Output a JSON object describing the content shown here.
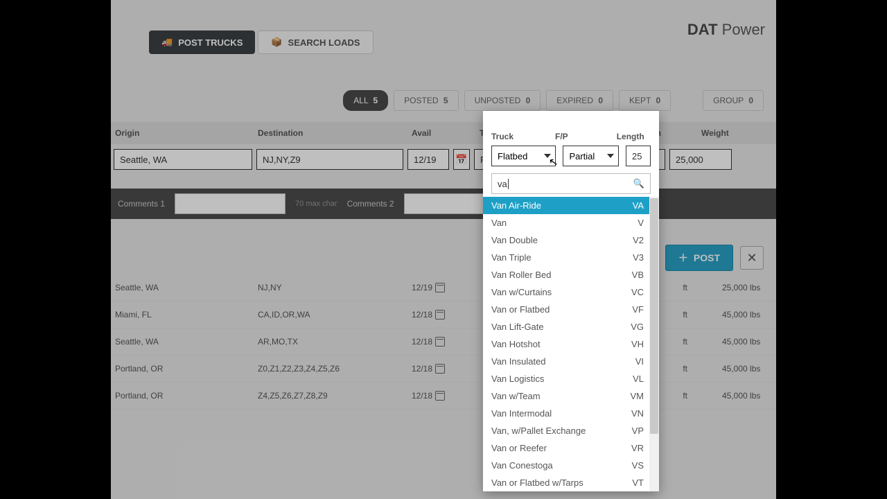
{
  "brand": {
    "bold": "DAT",
    "light": "Power"
  },
  "modes": {
    "post_trucks": "POST TRUCKS",
    "search_loads": "SEARCH LOADS"
  },
  "tabs": {
    "all": {
      "label": "ALL",
      "count": "5"
    },
    "posted": {
      "label": "POSTED",
      "count": "5"
    },
    "unposted": {
      "label": "UNPOSTED",
      "count": "0"
    },
    "expired": {
      "label": "EXPIRED",
      "count": "0"
    },
    "kept": {
      "label": "KEPT",
      "count": "0"
    },
    "group": {
      "label": "GROUP",
      "count": "0"
    }
  },
  "cols": {
    "origin": "Origin",
    "destination": "Destination",
    "avail": "Avail",
    "truck": "Truck",
    "fp": "F/P",
    "length": "Length",
    "weight": "Weight"
  },
  "form": {
    "origin": "Seattle, WA",
    "destination": "NJ,NY,Z9",
    "avail": "12/19",
    "truck": "Flatbed",
    "fp": "Partial",
    "length": "25",
    "weight": "25,000",
    "comments1_label": "Comments 1",
    "comments1_max": "70 max char",
    "comments2_label": "Comments 2"
  },
  "dropdown": {
    "search_value": "va",
    "options": [
      {
        "name": "Van Air-Ride",
        "code": "VA",
        "hl": true
      },
      {
        "name": "Van",
        "code": "V"
      },
      {
        "name": "Van Double",
        "code": "V2"
      },
      {
        "name": "Van Triple",
        "code": "V3"
      },
      {
        "name": "Van Roller Bed",
        "code": "VB"
      },
      {
        "name": "Van w/Curtains",
        "code": "VC"
      },
      {
        "name": "Van or Flatbed",
        "code": "VF"
      },
      {
        "name": "Van Lift-Gate",
        "code": "VG"
      },
      {
        "name": "Van Hotshot",
        "code": "VH"
      },
      {
        "name": "Van Insulated",
        "code": "VI"
      },
      {
        "name": "Van Logistics",
        "code": "VL"
      },
      {
        "name": "Van w/Team",
        "code": "VM"
      },
      {
        "name": "Van Intermodal",
        "code": "VN"
      },
      {
        "name": "Van, w/Pallet Exchange",
        "code": "VP"
      },
      {
        "name": "Van or Reefer",
        "code": "VR"
      },
      {
        "name": "Van Conestoga",
        "code": "VS"
      },
      {
        "name": "Van or Flatbed w/Tarps",
        "code": "VT"
      }
    ]
  },
  "actions": {
    "post": "POST"
  },
  "rows": [
    {
      "origin": "Seattle, WA",
      "dest": "NJ,NY",
      "avail": "12/19",
      "len": "ft",
      "wt": "25,000 lbs"
    },
    {
      "origin": "Miami, FL",
      "dest": "CA,ID,OR,WA",
      "avail": "12/18",
      "len": "ft",
      "wt": "45,000 lbs"
    },
    {
      "origin": "Seattle, WA",
      "dest": "AR,MO,TX",
      "avail": "12/18",
      "len": "ft",
      "wt": "45,000 lbs"
    },
    {
      "origin": "Portland, OR",
      "dest": "Z0,Z1,Z2,Z3,Z4,Z5,Z6",
      "avail": "12/18",
      "len": "ft",
      "wt": "45,000 lbs"
    },
    {
      "origin": "Portland, OR",
      "dest": "Z4,Z5,Z6,Z7,Z8,Z9",
      "avail": "12/18",
      "len": "ft",
      "wt": "45,000 lbs"
    }
  ]
}
